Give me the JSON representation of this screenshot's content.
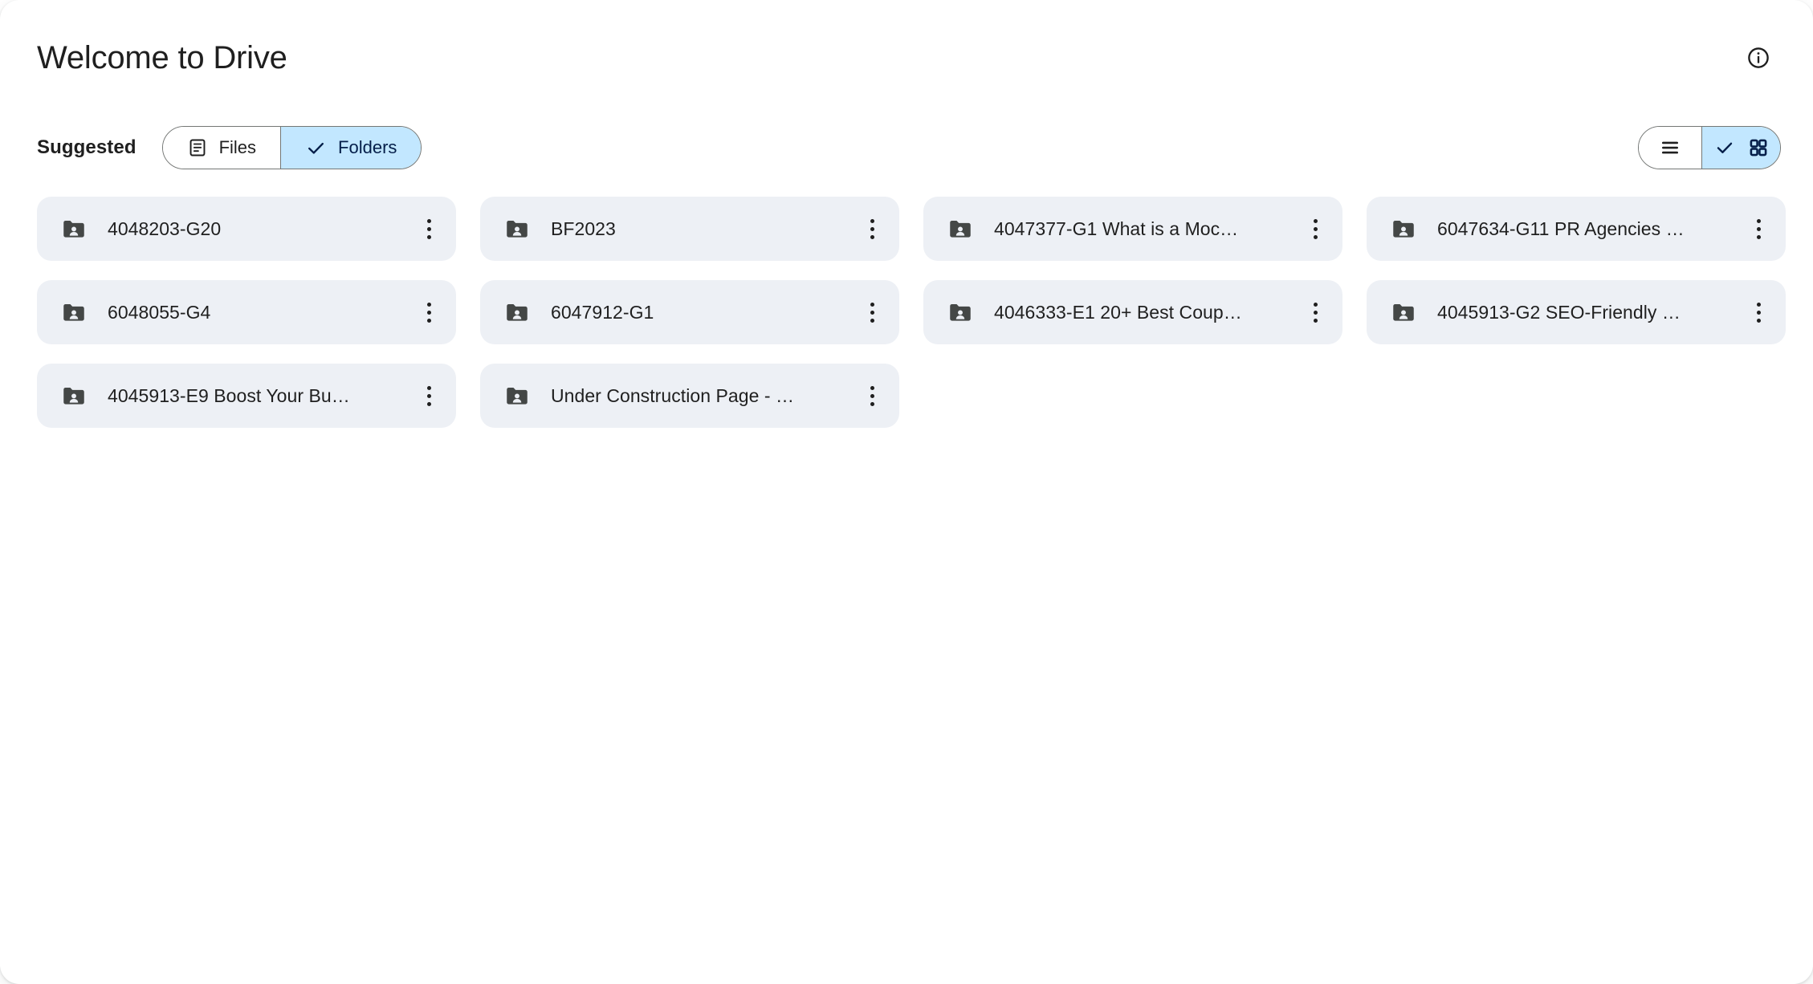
{
  "header": {
    "title": "Welcome to Drive",
    "info_icon": "info-circle-icon"
  },
  "controls": {
    "suggested_label": "Suggested",
    "filters": [
      {
        "label": "Files",
        "icon": "document-list-icon",
        "selected": false
      },
      {
        "label": "Folders",
        "icon": "check-icon",
        "selected": true
      }
    ],
    "views": [
      {
        "name": "list-view",
        "icon": "list-icon",
        "selected": false
      },
      {
        "name": "grid-view",
        "icon": "grid-icon",
        "selected": true,
        "check_icon": "check-icon"
      }
    ]
  },
  "suggested": {
    "item_icon": "shared-folder-icon",
    "overflow_icon": "more-vert-icon",
    "rows": [
      [
        {
          "name": "4048203-G20"
        },
        {
          "name": "BF2023"
        },
        {
          "name": "4047377-G1 What is a Moc…"
        },
        {
          "name": "6047634-G11 PR Agencies …"
        }
      ],
      [
        {
          "name": "6048055-G4"
        },
        {
          "name": "6047912-G1"
        },
        {
          "name": "4046333-E1 20+ Best Coup…"
        },
        {
          "name": "4045913-G2 SEO-Friendly …"
        }
      ],
      [
        {
          "name": "4045913-E9 Boost Your Bu…"
        },
        {
          "name": "Under Construction Page - …"
        },
        {
          "name": "",
          "empty": true
        },
        {
          "name": "",
          "empty": true
        }
      ]
    ]
  },
  "colors": {
    "card_background": "#edf0f5",
    "selected_segment": "#c2e7ff",
    "selected_segment_text": "#041e49",
    "folder_icon": "#444746",
    "text_primary": "#1f1f1f",
    "outline": "#747775",
    "surface": "#ffffff"
  }
}
